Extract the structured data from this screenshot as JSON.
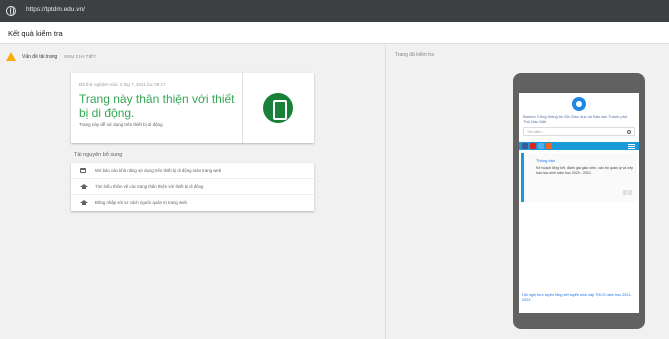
{
  "browser": {
    "url": "https://tptdm.edu.vn/"
  },
  "header": {
    "title": "Kết quả kiểm tra"
  },
  "issues": {
    "label": "Vấn đề tải trang",
    "link": "XEM CHI TIẾT"
  },
  "result": {
    "tested_at": "Đã thử nghiệm vào: 3 thg 7, 2021 lúc 08:17",
    "headline": "Trang này thân thiện với thiết bị di động.",
    "subtext": "Trang này dễ sử dụng trên thiết bị di động",
    "accent_color": "#34a853",
    "icon": "phone-icon"
  },
  "resources": {
    "title": "Tài nguyên bổ sung",
    "items": [
      {
        "icon": "calendar-icon",
        "label": "Mở báo cáo khả năng sử dụng trên thiết bị di động toàn trang web"
      },
      {
        "icon": "school-icon",
        "label": "Tìm hiểu thêm về các trang thân thiện với thiết bị di động"
      },
      {
        "icon": "school-icon",
        "label": "Đăng nhập với tư cách người quản trị trang web"
      }
    ]
  },
  "preview": {
    "label": "Trang đã kiểm tra",
    "broken_image_alt": "Banner Cổng thông tin Sở Giáo dục và Đào tạo Thành phố Thủ Dầu Một",
    "search_placeholder": "Tìm kiếm...",
    "notice_title": "Thông báo",
    "notice_text": "Kế hoạch tổng kết, đánh giá giáo viên, cán bộ quản lý và xếp loại học sinh năm học 2020 - 2021",
    "bottom_link": "Hội nghị trực tuyến tổng kết tuyển sinh cấp THCS năm học 2021-2022"
  }
}
